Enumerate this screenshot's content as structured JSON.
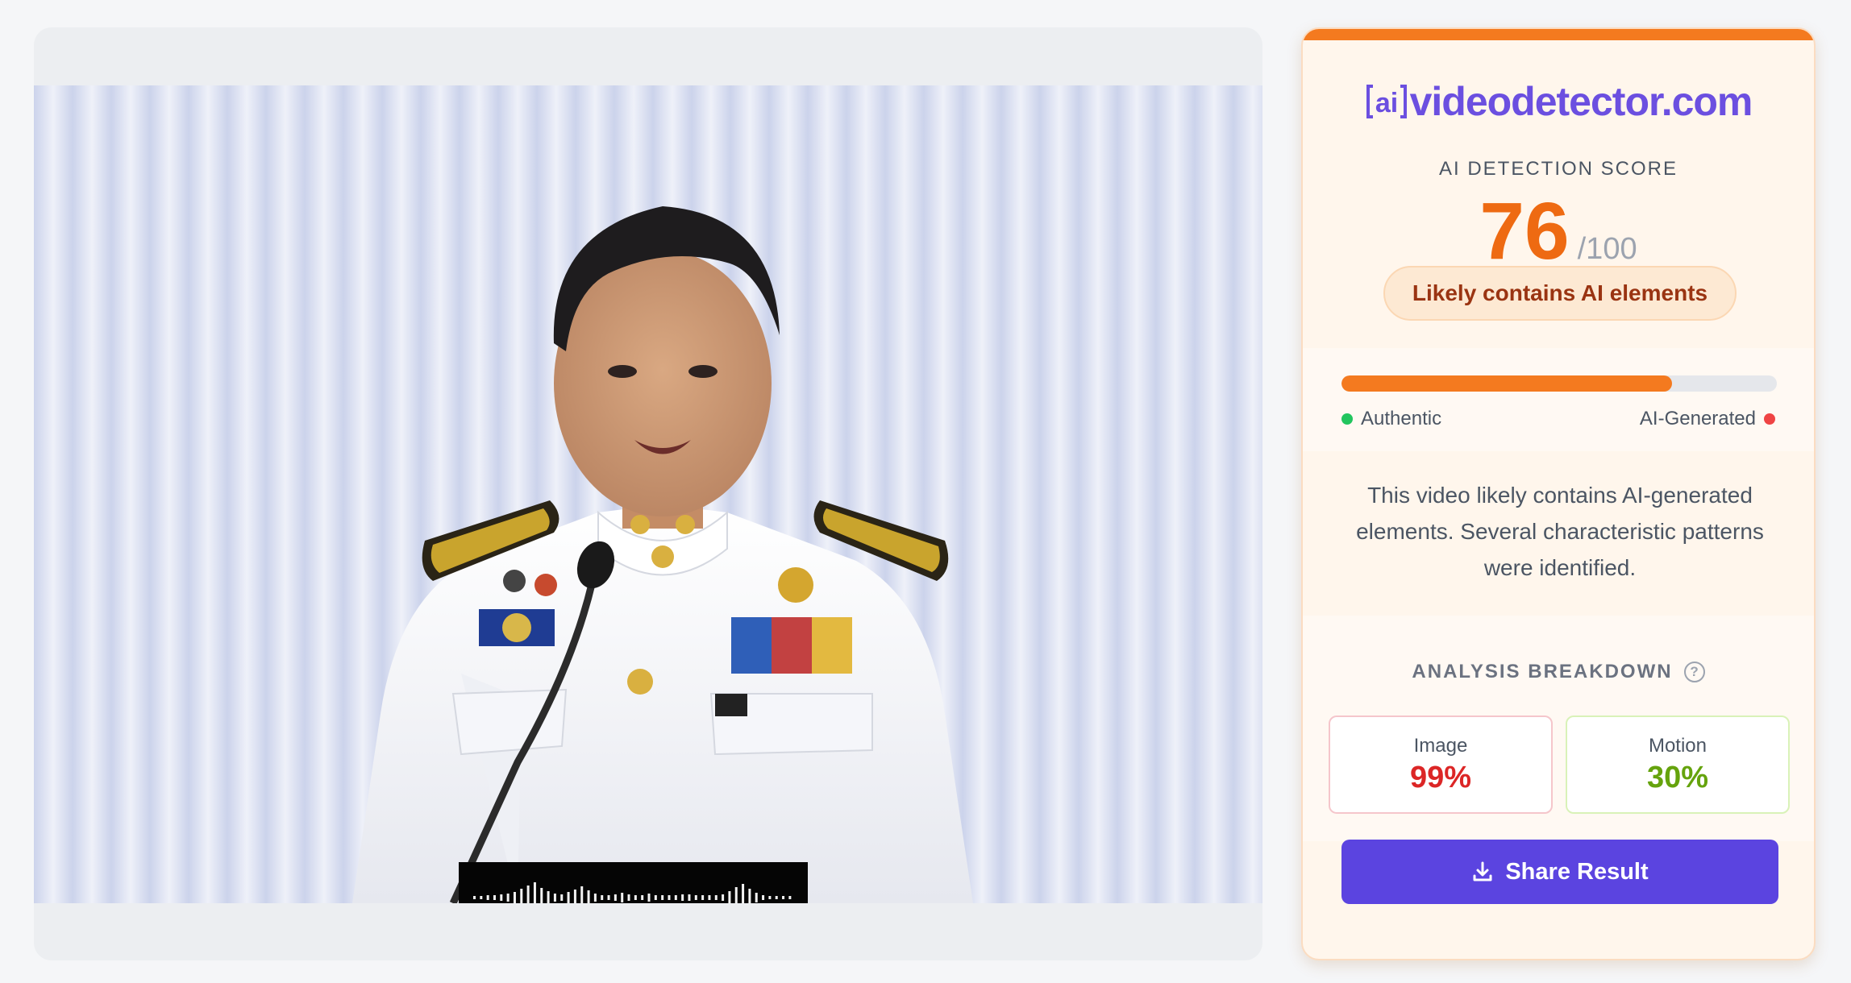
{
  "brand": {
    "logo_mark": "ai",
    "name": "videodetector.com",
    "accent_color": "#6b4fe0"
  },
  "result": {
    "score_label": "AI DETECTION SCORE",
    "score": "76",
    "score_max": "/100",
    "score_fraction": 0.76,
    "score_color": "#ee6a12",
    "verdict": "Likely contains AI elements"
  },
  "meter": {
    "left_label": "Authentic",
    "right_label": "AI-Generated",
    "fill_fraction": 0.76
  },
  "summary": "This video likely contains AI-generated elements. Several characteristic patterns were identified.",
  "breakdown": {
    "title": "ANALYSIS BREAKDOWN",
    "help_symbol": "?",
    "metrics": [
      {
        "label": "Image",
        "value": "99%",
        "color": "#dc2626"
      },
      {
        "label": "Motion",
        "value": "30%",
        "color": "#65a30d"
      }
    ]
  },
  "share_button": {
    "label": "Share Result",
    "icon": "download-icon"
  },
  "video": {
    "subject": "video-frame-speaker",
    "overlay_icon": "audio-waveform-icon"
  }
}
